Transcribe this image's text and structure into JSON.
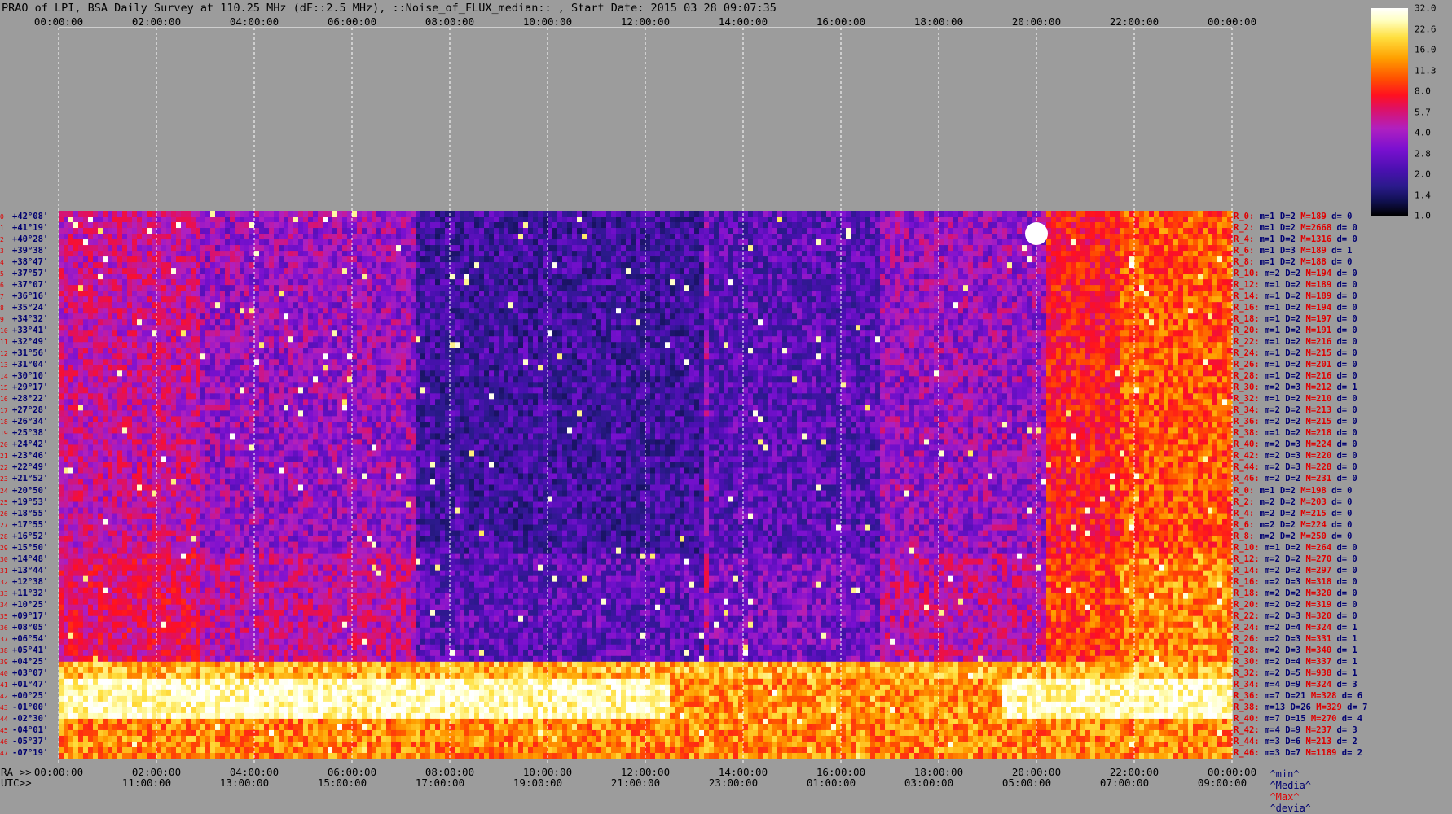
{
  "title": "PRAO of LPI, BSA Daily Survey at 110.25 MHz (dF::2.5 MHz), ::Noise_of_FLUX_median:: , Start Date: 2015 03 28 09:07:35",
  "top_ticks": [
    "00:00:00",
    "02:00:00",
    "04:00:00",
    "06:00:00",
    "08:00:00",
    "10:00:00",
    "12:00:00",
    "14:00:00",
    "16:00:00",
    "18:00:00",
    "20:00:00",
    "22:00:00",
    "00:00:00"
  ],
  "ra_label": "RA >>",
  "ra_ticks": [
    "00:00:00",
    "02:00:00",
    "04:00:00",
    "06:00:00",
    "08:00:00",
    "10:00:00",
    "12:00:00",
    "14:00:00",
    "16:00:00",
    "18:00:00",
    "20:00:00",
    "22:00:00",
    "00:00:00"
  ],
  "utc_label": "UTC>>",
  "utc_ticks": [
    "11:00:00",
    "13:00:00",
    "15:00:00",
    "17:00:00",
    "19:00:00",
    "21:00:00",
    "23:00:00",
    "01:00:00",
    "03:00:00",
    "05:00:00",
    "07:00:00",
    "09:00:00"
  ],
  "declinations": [
    "+42°08'",
    "+41°19'",
    "+40°28'",
    "+39°38'",
    "+38°47'",
    "+37°57'",
    "+37°07'",
    "+36°16'",
    "+35°24'",
    "+34°32'",
    "+33°41'",
    "+32°49'",
    "+31°56'",
    "+31°04'",
    "+30°10'",
    "+29°17'",
    "+28°22'",
    "+27°28'",
    "+26°34'",
    "+25°38'",
    "+24°42'",
    "+23°46'",
    "+22°49'",
    "+21°52'",
    "+20°50'",
    "+19°53'",
    "+18°55'",
    "+17°55'",
    "+16°52'",
    "+15°50'",
    "+14°48'",
    "+13°44'",
    "+12°38'",
    "+11°32'",
    "+10°25'",
    "+09°17'",
    "+08°05'",
    "+06°54'",
    "+05°41'",
    "+04°25'",
    "+03°07'",
    "+01°47'",
    "+00°25'",
    "-01°00'",
    "-02°30'",
    "-04°01'",
    "-05°37'",
    "-07°19'"
  ],
  "stats": [
    {
      "r": "R_0:",
      "m": "1",
      "d": "2",
      "M": "189",
      "dev": "0"
    },
    {
      "r": "R_2:",
      "m": "1",
      "d": "2",
      "M": "2668",
      "dev": "0"
    },
    {
      "r": "R_4:",
      "m": "1",
      "d": "2",
      "M": "1316",
      "dev": "0"
    },
    {
      "r": "R_6:",
      "m": "1",
      "d": "3",
      "M": "189",
      "dev": "1"
    },
    {
      "r": "R_8:",
      "m": "1",
      "d": "2",
      "M": "188",
      "dev": "0"
    },
    {
      "r": "R_10:",
      "m": "2",
      "d": "2",
      "M": "194",
      "dev": "0"
    },
    {
      "r": "R_12:",
      "m": "1",
      "d": "2",
      "M": "189",
      "dev": "0"
    },
    {
      "r": "R_14:",
      "m": "1",
      "d": "2",
      "M": "189",
      "dev": "0"
    },
    {
      "r": "R_16:",
      "m": "1",
      "d": "2",
      "M": "194",
      "dev": "0"
    },
    {
      "r": "R_18:",
      "m": "1",
      "d": "2",
      "M": "197",
      "dev": "0"
    },
    {
      "r": "R_20:",
      "m": "1",
      "d": "2",
      "M": "191",
      "dev": "0"
    },
    {
      "r": "R_22:",
      "m": "1",
      "d": "2",
      "M": "216",
      "dev": "0"
    },
    {
      "r": "R_24:",
      "m": "1",
      "d": "2",
      "M": "215",
      "dev": "0"
    },
    {
      "r": "R_26:",
      "m": "1",
      "d": "2",
      "M": "201",
      "dev": "0"
    },
    {
      "r": "R_28:",
      "m": "1",
      "d": "2",
      "M": "216",
      "dev": "0"
    },
    {
      "r": "R_30:",
      "m": "2",
      "d": "3",
      "M": "212",
      "dev": "1"
    },
    {
      "r": "R_32:",
      "m": "1",
      "d": "2",
      "M": "210",
      "dev": "0"
    },
    {
      "r": "R_34:",
      "m": "2",
      "d": "2",
      "M": "213",
      "dev": "0"
    },
    {
      "r": "R_36:",
      "m": "2",
      "d": "2",
      "M": "215",
      "dev": "0"
    },
    {
      "r": "R_38:",
      "m": "1",
      "d": "2",
      "M": "218",
      "dev": "0"
    },
    {
      "r": "R_40:",
      "m": "2",
      "d": "3",
      "M": "224",
      "dev": "0"
    },
    {
      "r": "R_42:",
      "m": "2",
      "d": "3",
      "M": "220",
      "dev": "0"
    },
    {
      "r": "R_44:",
      "m": "2",
      "d": "3",
      "M": "228",
      "dev": "0"
    },
    {
      "r": "R_46:",
      "m": "2",
      "d": "2",
      "M": "231",
      "dev": "0"
    },
    {
      "r": "R_0:",
      "m": "1",
      "d": "2",
      "M": "198",
      "dev": "0"
    },
    {
      "r": "R_2:",
      "m": "2",
      "d": "2",
      "M": "203",
      "dev": "0"
    },
    {
      "r": "R_4:",
      "m": "2",
      "d": "2",
      "M": "215",
      "dev": "0"
    },
    {
      "r": "R_6:",
      "m": "2",
      "d": "2",
      "M": "224",
      "dev": "0"
    },
    {
      "r": "R_8:",
      "m": "2",
      "d": "2",
      "M": "250",
      "dev": "0"
    },
    {
      "r": "R_10:",
      "m": "1",
      "d": "2",
      "M": "264",
      "dev": "0"
    },
    {
      "r": "R_12:",
      "m": "2",
      "d": "2",
      "M": "270",
      "dev": "0"
    },
    {
      "r": "R_14:",
      "m": "2",
      "d": "2",
      "M": "297",
      "dev": "0"
    },
    {
      "r": "R_16:",
      "m": "2",
      "d": "3",
      "M": "318",
      "dev": "0"
    },
    {
      "r": "R_18:",
      "m": "2",
      "d": "2",
      "M": "320",
      "dev": "0"
    },
    {
      "r": "R_20:",
      "m": "2",
      "d": "2",
      "M": "319",
      "dev": "0"
    },
    {
      "r": "R_22:",
      "m": "2",
      "d": "3",
      "M": "320",
      "dev": "0"
    },
    {
      "r": "R_24:",
      "m": "2",
      "d": "4",
      "M": "324",
      "dev": "1"
    },
    {
      "r": "R_26:",
      "m": "2",
      "d": "3",
      "M": "331",
      "dev": "1"
    },
    {
      "r": "R_28:",
      "m": "2",
      "d": "3",
      "M": "340",
      "dev": "1"
    },
    {
      "r": "R_30:",
      "m": "2",
      "d": "4",
      "M": "337",
      "dev": "1"
    },
    {
      "r": "R_32:",
      "m": "2",
      "d": "5",
      "M": "938",
      "dev": "1"
    },
    {
      "r": "R_34:",
      "m": "4",
      "d": "9",
      "M": "324",
      "dev": "3"
    },
    {
      "r": "R_36:",
      "m": "7",
      "d": "21",
      "M": "328",
      "dev": "6"
    },
    {
      "r": "R_38:",
      "m": "13",
      "d": "26",
      "M": "329",
      "dev": "7"
    },
    {
      "r": "R_40:",
      "m": "7",
      "d": "15",
      "M": "270",
      "dev": "4"
    },
    {
      "r": "R_42:",
      "m": "4",
      "d": "9",
      "M": "237",
      "dev": "3"
    },
    {
      "r": "R_44:",
      "m": "3",
      "d": "6",
      "M": "213",
      "dev": "2"
    },
    {
      "r": "R_46:",
      "m": "3",
      "d": "7",
      "M": "1189",
      "dev": "2"
    }
  ],
  "stats_legend": {
    "min": "^min^",
    "media": "^Media^",
    "max": "^Max^",
    "devia": "^devia^"
  },
  "colorbar_ticks": [
    "32.0",
    "22.6",
    "16.0",
    "11.3",
    "8.0",
    "5.7",
    "4.0",
    "2.8",
    "2.0",
    "1.4",
    "1.0"
  ],
  "colors": {
    "background": "#9c9c9c",
    "label_red": "#e00000",
    "label_navy": "#000070"
  },
  "chart_data": {
    "type": "heatmap",
    "title": "PRAO of LPI, BSA Daily Survey at 110.25 MHz (dF::2.5 MHz), ::Noise_of_FLUX_median:: , Start Date: 2015 03 28 09:07:35",
    "x": [
      "00:00:00",
      "02:00:00",
      "04:00:00",
      "06:00:00",
      "08:00:00",
      "10:00:00",
      "12:00:00",
      "14:00:00",
      "16:00:00",
      "18:00:00",
      "20:00:00",
      "22:00:00",
      "00:00:00"
    ],
    "y_range_dec": [
      "+42°08'",
      "-07°19'"
    ],
    "colorbar_range": [
      1.0,
      32.0
    ],
    "colorbar_scale": "log",
    "rows": 48
  }
}
